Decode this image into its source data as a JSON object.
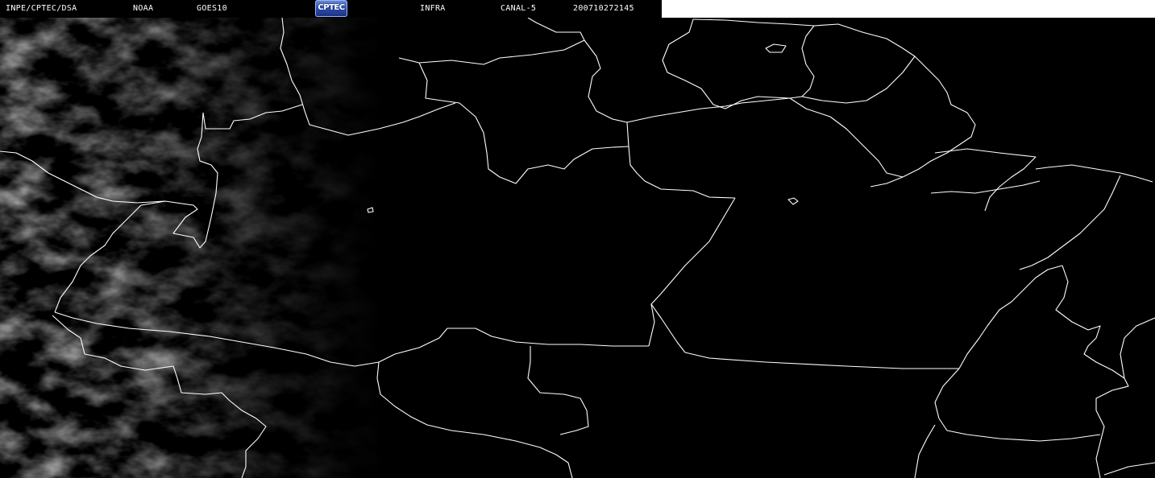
{
  "header": {
    "source": "INPE/CPTEC/DSA",
    "agency": "NOAA",
    "satellite": "GOES10",
    "logo_text": "CPTEC",
    "band": "INFRA",
    "channel": "CANAL-5",
    "timestamp": "200710272145"
  },
  "colors": {
    "background": "#000000",
    "border_lines": "#ffffff",
    "cloud_gray": "#8a8a8a",
    "header_right_panel": "#ffffff"
  }
}
